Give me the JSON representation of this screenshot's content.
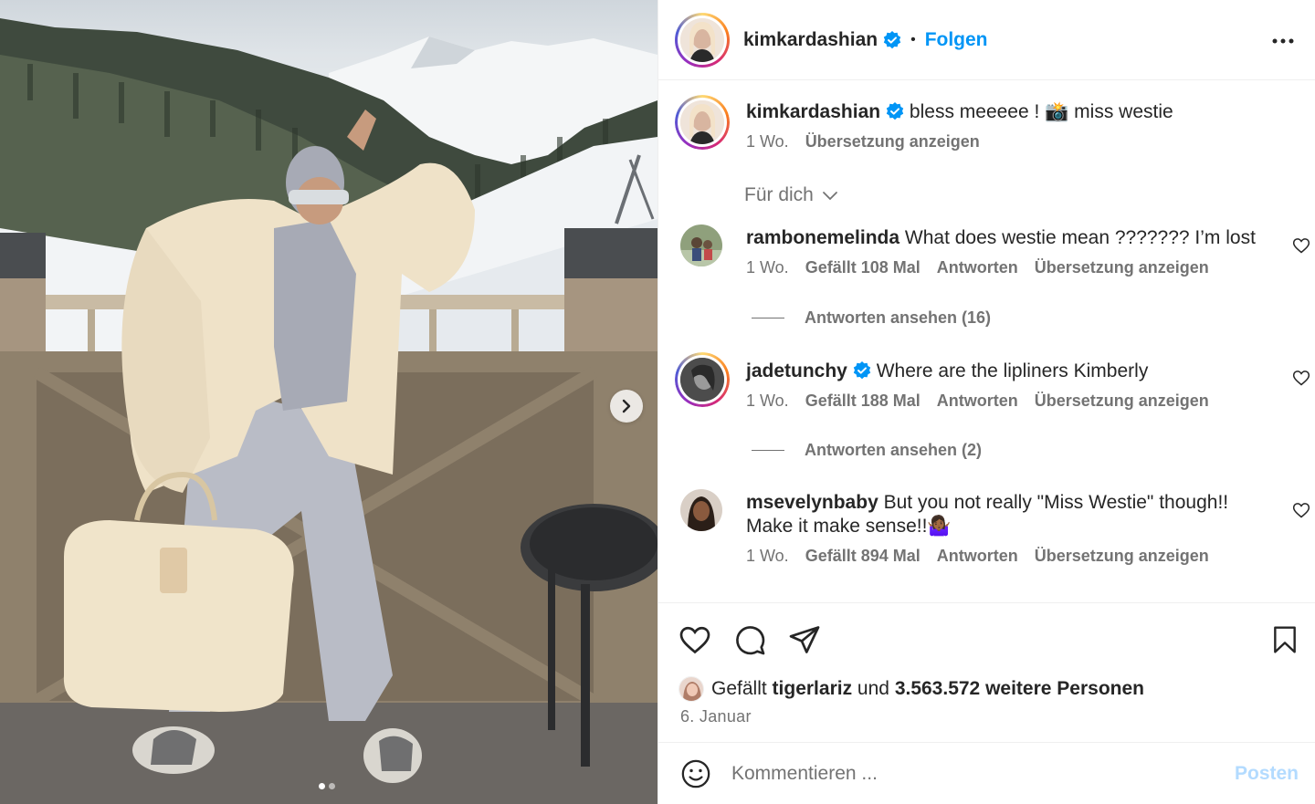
{
  "post": {
    "author": "kimkardashian",
    "follow_label": "Folgen",
    "separator": "•",
    "caption": "bless meeeee ! 📸 miss westie",
    "caption_time": "1 Wo.",
    "caption_translate": "Übersetzung anzeigen",
    "image_count": 2,
    "image_active_index": 0
  },
  "comments_filter": "Für dich",
  "comments": [
    {
      "username": "rambonemelinda",
      "verified": false,
      "text": "What does westie mean ??????? I’m lost",
      "time": "1 Wo.",
      "likes": "Gefällt 108 Mal",
      "reply": "Antworten",
      "translate": "Übersetzung anzeigen",
      "view_replies": "Antworten ansehen (16)"
    },
    {
      "username": "jadetunchy",
      "verified": true,
      "text": "Where are the lipliners Kimberly",
      "time": "1 Wo.",
      "likes": "Gefällt 188 Mal",
      "reply": "Antworten",
      "translate": "Übersetzung anzeigen",
      "view_replies": "Antworten ansehen (2)"
    },
    {
      "username": "msevelynbaby",
      "verified": false,
      "text": "But you not really \"Miss Westie\" though!! Make it make sense!!🤷🏾‍♀️",
      "time": "1 Wo.",
      "likes": "Gefällt 894 Mal",
      "reply": "Antworten",
      "translate": "Übersetzung anzeigen"
    }
  ],
  "likes_line": {
    "prefix": "Gefällt",
    "user": "tigerlariz",
    "connector": "und",
    "others": "3.563.572 weitere Personen"
  },
  "post_date": "6. Januar",
  "comment_input": {
    "placeholder": "Kommentieren ...",
    "value": ""
  },
  "post_button": "Posten",
  "icons": {
    "verified": "verified-badge-icon",
    "more": "more-options-icon",
    "like": "heart-icon",
    "comment": "comment-bubble-icon",
    "share": "paper-plane-icon",
    "save": "bookmark-icon",
    "emoji": "smiley-icon",
    "next": "chevron-right-icon",
    "filter": "chevron-down-icon"
  },
  "colors": {
    "accent": "#0095f6",
    "post_disabled": "#b3dbff",
    "verified": "#0095f6",
    "muted": "#737373"
  }
}
